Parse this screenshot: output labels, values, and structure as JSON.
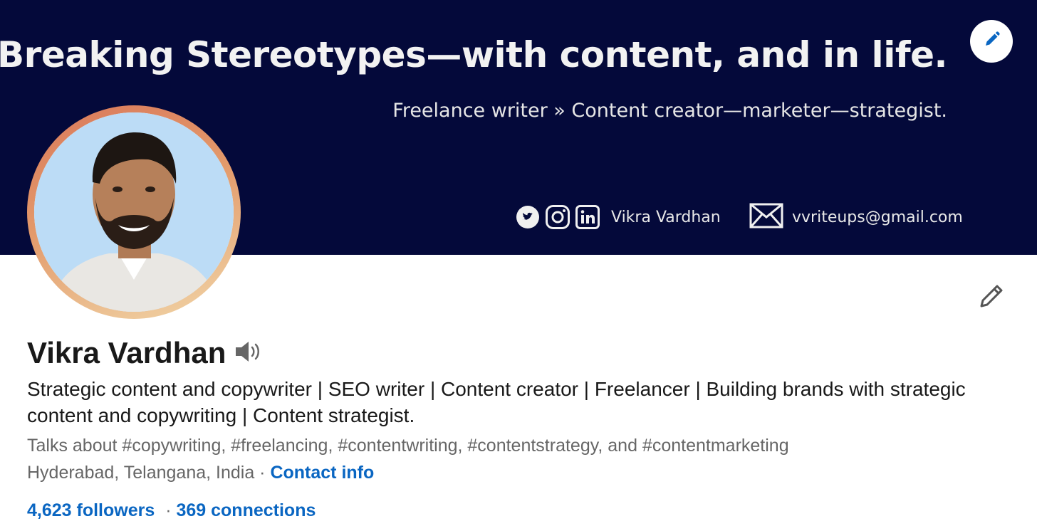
{
  "banner": {
    "title": "Breaking Stereotypes—with content, and in life.",
    "subtitle": "Freelance writer » Content creator—marketer—strategist.",
    "social_icons": [
      "twitter-icon",
      "instagram-icon",
      "linkedin-icon"
    ],
    "social_handle": "Vikra Vardhan",
    "email": "vvriteups@gmail.com",
    "background_color": "#04093a"
  },
  "profile": {
    "name": "Vikra Vardhan",
    "headline": "Strategic content and copywriter | SEO writer | Content creator | Freelancer | Building brands with strategic content and copywriting | Content strategist.",
    "talks_about": "Talks about #copywriting, #freelancing, #contentwriting, #contentstrategy, and #contentmarketing",
    "location": "Hyderabad, Telangana, India",
    "separator": " · ",
    "contact_info_label": "Contact info",
    "followers": "4,623 followers",
    "stats_separator": " · ",
    "connections": "369 connections",
    "link_color": "#0a66c2"
  }
}
